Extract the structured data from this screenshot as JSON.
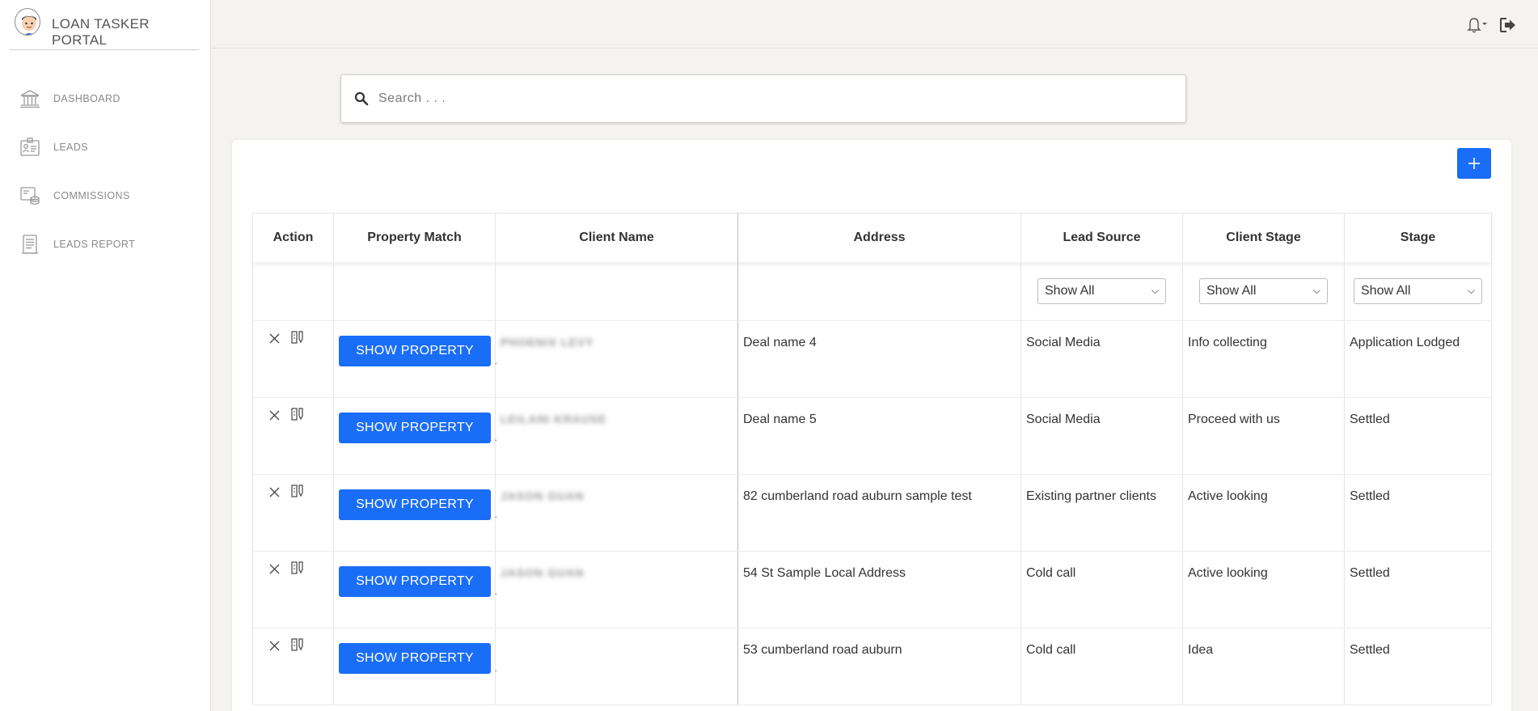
{
  "app": {
    "title": "LOAN TASKER PORTAL"
  },
  "sidebar": {
    "items": [
      {
        "label": "DASHBOARD",
        "icon": "bank-icon"
      },
      {
        "label": "LEADS",
        "icon": "id-card-icon"
      },
      {
        "label": "COMMISSIONS",
        "icon": "commissions-icon"
      },
      {
        "label": "LEADS REPORT",
        "icon": "report-icon"
      }
    ]
  },
  "topbar": {
    "icons": [
      "bell-icon",
      "logout-icon"
    ]
  },
  "search": {
    "placeholder": "Search . . ."
  },
  "table": {
    "columns": [
      "Action",
      "Property Match",
      "Client Name",
      "Address",
      "Lead Source",
      "Client Stage",
      "Stage"
    ],
    "filters": {
      "lead_source": "Show All",
      "client_stage": "Show All",
      "stage": "Show All"
    },
    "show_property_label": "SHOW PROPERTY",
    "rows": [
      {
        "client_name": "PHOENIX LEVY",
        "address": "Deal name 4",
        "lead_source": "Social Media",
        "client_stage": "Info collecting",
        "stage": "Application Lodged"
      },
      {
        "client_name": "LEILANI KRAUSE",
        "address": "Deal name 5",
        "lead_source": "Social Media",
        "client_stage": "Proceed with us",
        "stage": "Settled"
      },
      {
        "client_name": "JASON GUAN",
        "address": "82 cumberland road auburn sample test",
        "lead_source": "Existing partner clients",
        "client_stage": "Active looking",
        "stage": "Settled"
      },
      {
        "client_name": "JASON GUAN",
        "address": "54 St Sample Local Address",
        "lead_source": "Cold call",
        "client_stage": "Active looking",
        "stage": "Settled"
      },
      {
        "client_name": "",
        "address": "53 cumberland road auburn",
        "lead_source": "Cold call",
        "client_stage": "Idea",
        "stage": "Settled"
      }
    ]
  },
  "colors": {
    "primary": "#1a6df7",
    "background": "#f4f3ef",
    "sidebar": "#ffffff"
  }
}
